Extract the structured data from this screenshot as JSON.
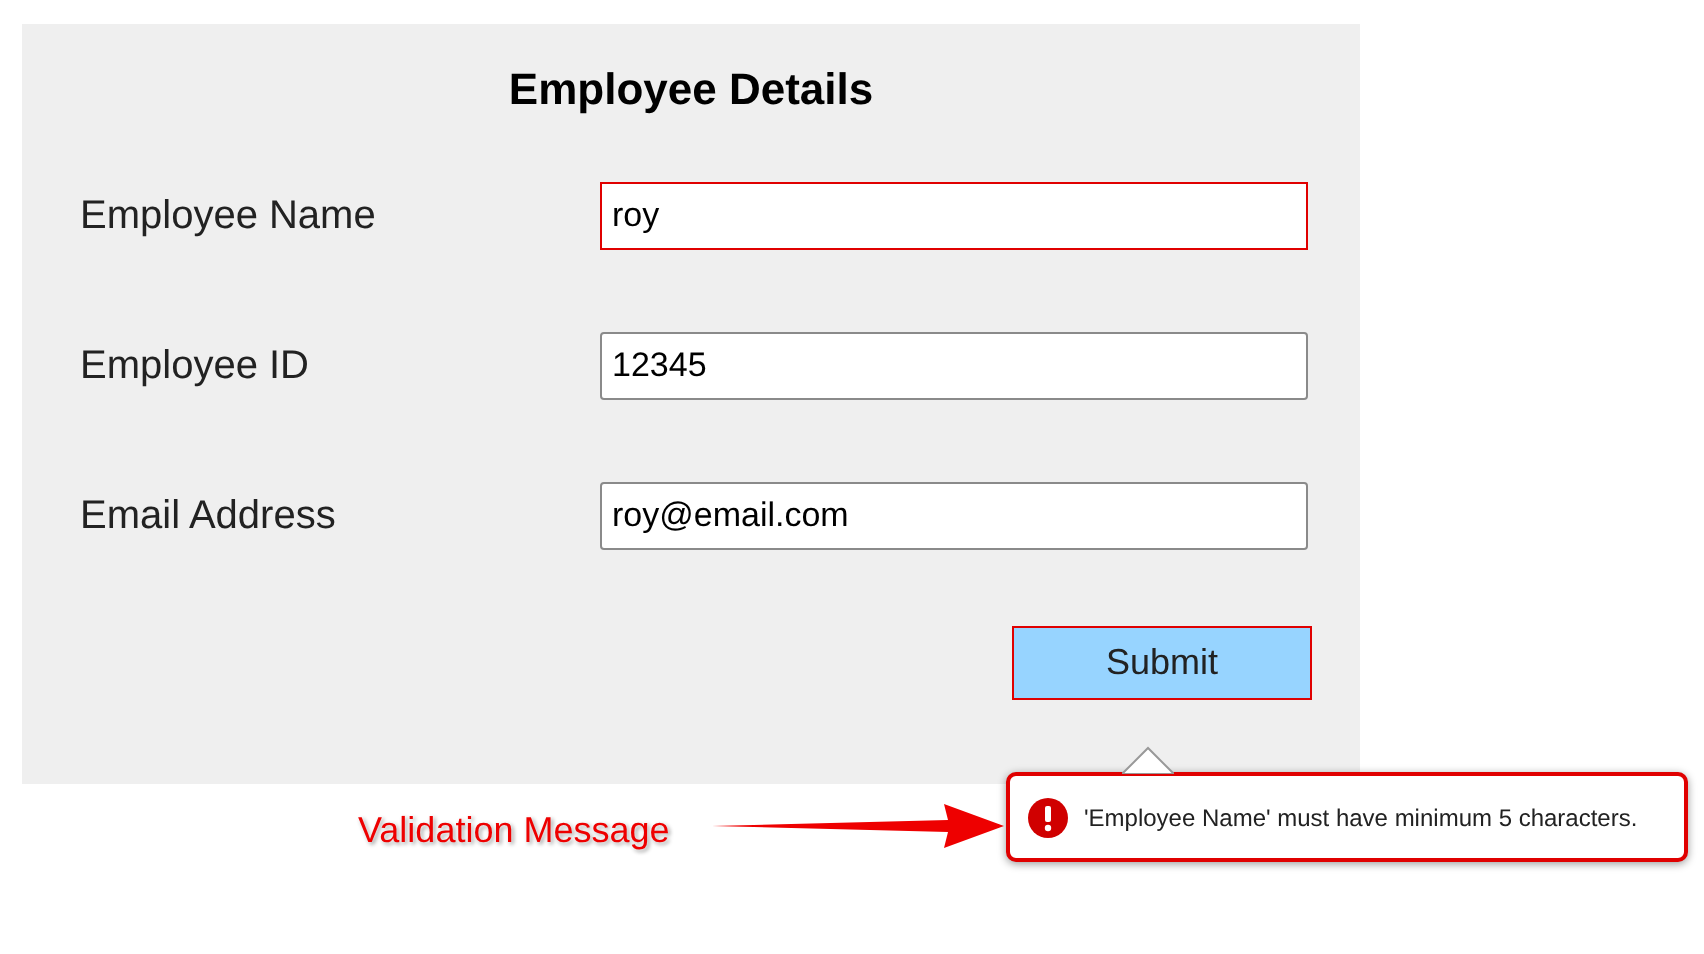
{
  "form": {
    "title": "Employee Details",
    "fields": [
      {
        "label": "Employee Name",
        "value": "roy",
        "invalid": true
      },
      {
        "label": "Employee ID",
        "value": "12345",
        "invalid": false
      },
      {
        "label": "Email Address",
        "value": "roy@email.com",
        "invalid": false
      }
    ],
    "submit": {
      "label": "Submit",
      "invalid": true
    }
  },
  "tooltip": {
    "message": "'Employee Name' must have minimum 5 characters."
  },
  "annotation": {
    "label": "Validation Message"
  }
}
